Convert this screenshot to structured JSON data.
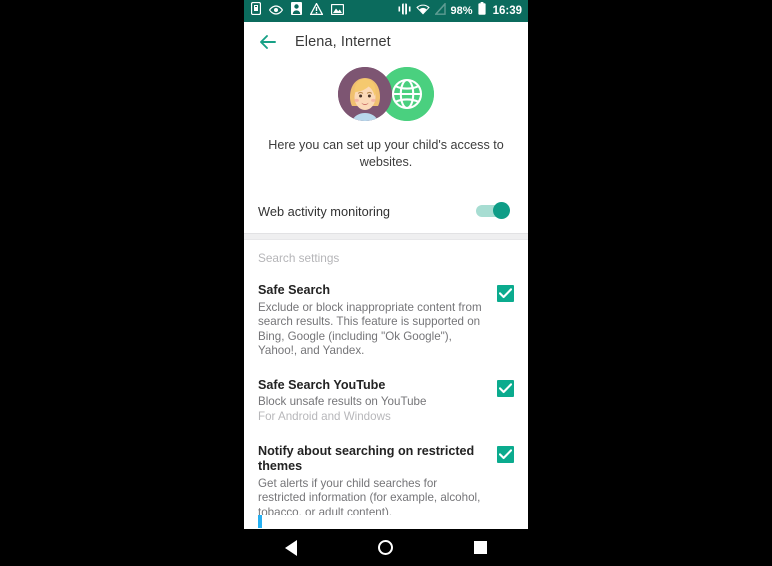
{
  "statusbar": {
    "left_icons": [
      "sim-card-icon",
      "eye-icon",
      "contact-icon",
      "warning-triangle-icon",
      "image-icon"
    ],
    "right_icons": [
      "vibrate-icon",
      "wifi-icon",
      "signal-off-icon"
    ],
    "battery_percent": "98%",
    "battery_icon": "battery-full-icon",
    "time": "16:39",
    "background_color": "#0b6b5d"
  },
  "appbar": {
    "back_label": "back-arrow",
    "title": "Elena, Internet",
    "accent_color": "#16a085"
  },
  "hero": {
    "avatar_child": "child-avatar",
    "avatar_globe": "globe-icon",
    "description": "Here you can set up your child's access to websites."
  },
  "monitoring": {
    "label": "Web activity monitoring",
    "enabled": true,
    "track_color": "#a7ddd2",
    "thumb_color": "#0f9d87"
  },
  "search_settings": {
    "section_title": "Search settings",
    "items": [
      {
        "title": "Safe Search",
        "description": "Exclude or block inappropriate content from search results. This feature is supported on Bing, Google (including \"Ok Google\"), Yahoo!, and Yandex.",
        "note": "",
        "checked": true
      },
      {
        "title": "Safe Search YouTube",
        "description": "Block unsafe results on YouTube",
        "note": "For Android and Windows",
        "checked": true
      },
      {
        "title": "Notify about searching on restricted themes",
        "description": "Get alerts if your child searches for restricted information (for example, alcohol, tobacco, or adult content).",
        "note": "",
        "checked": true
      }
    ],
    "checkbox_color": "#0bab8e"
  },
  "scroll_indicator": {
    "color": "#26b0f2"
  },
  "navbar": {
    "back": "nav-back-icon",
    "home": "nav-home-icon",
    "recents": "nav-recents-icon"
  }
}
